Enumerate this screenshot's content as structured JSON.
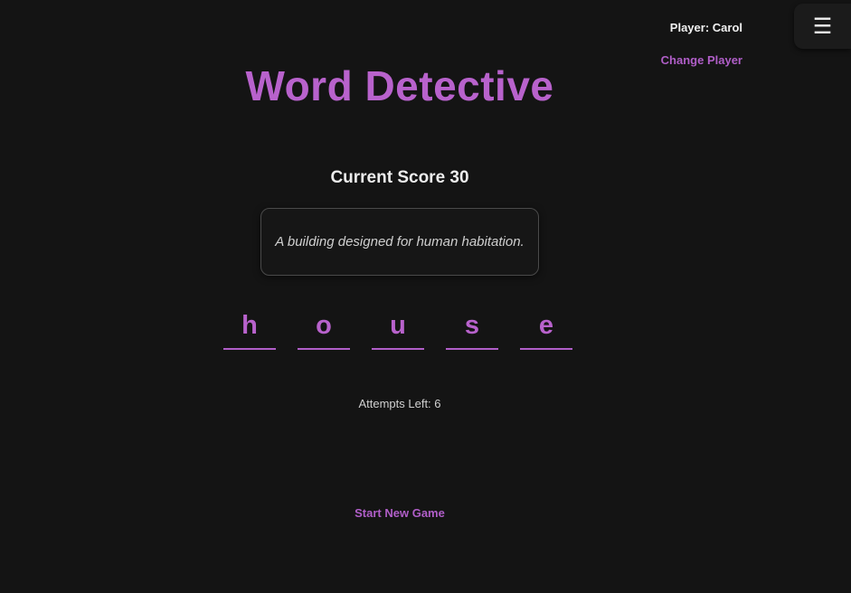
{
  "header": {
    "player_label": "Player: Carol",
    "change_player_label": "Change Player",
    "menu_icon": "hamburger-menu-icon",
    "menu_glyph": "☰"
  },
  "title": "Word Detective",
  "score_text": "Current Score 30",
  "hint": "A building designed for human habitation.",
  "letters": [
    "h",
    "o",
    "u",
    "s",
    "e"
  ],
  "attempts_text": "Attempts Left: 6",
  "new_game_label": "Start New Game",
  "colors": {
    "background": "#141414",
    "accent": "#b862cc",
    "text": "#e6e6e6"
  }
}
